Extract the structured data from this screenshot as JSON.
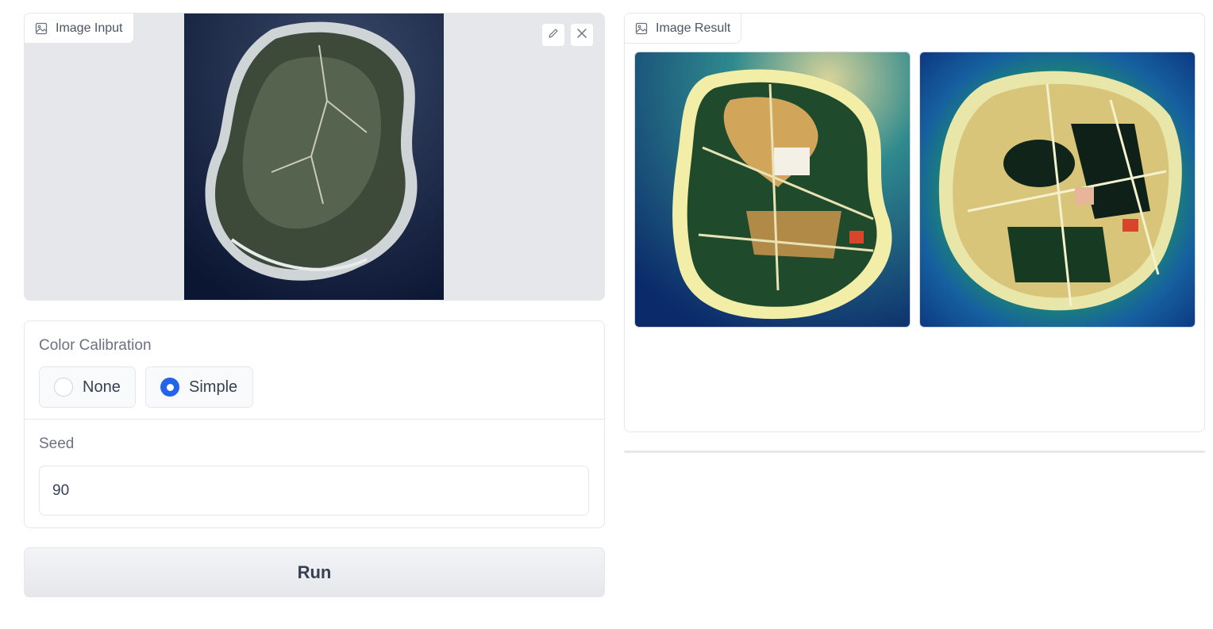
{
  "image_input": {
    "label": "Image Input",
    "icon": "image-icon",
    "tools": [
      "pencil-icon",
      "close-icon"
    ]
  },
  "color_calibration": {
    "label": "Color Calibration",
    "options": [
      "None",
      "Simple"
    ],
    "selected": "Simple"
  },
  "seed": {
    "label": "Seed",
    "value": "90"
  },
  "run_button": {
    "label": "Run"
  },
  "image_result": {
    "label": "Image Result",
    "icon": "image-icon"
  },
  "colors": {
    "accent": "#2563eb",
    "border": "#e5e7eb",
    "panel_bg": "#e5e7eb"
  }
}
